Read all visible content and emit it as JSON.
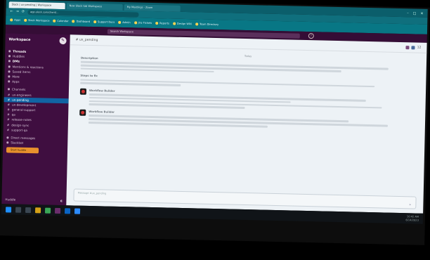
{
  "browser": {
    "tabs": [
      {
        "label": "Slack | ux-pending | Workspace"
      },
      {
        "label": "New Slack tab Workspace"
      },
      {
        "label": "My Meetings - Zoom"
      }
    ],
    "url": "app.slack.com/client/...",
    "bookmarks": [
      "Apps",
      "Slack Workspace",
      "Calendar",
      "Dashboard",
      "Support Docs",
      "Admin",
      "Jira Tickets",
      "Reports",
      "Design Wiki",
      "Team Directory"
    ]
  },
  "slack": {
    "workspace_name": "Workspace",
    "search_placeholder": "Search Workspace",
    "sidebar": {
      "top_items": [
        "Threads",
        "Huddles",
        "DMs",
        "Mentions & reactions",
        "Saved items",
        "More",
        "Apps"
      ],
      "channels_header": "Channels",
      "channels": [
        "ux-engineers",
        "ux-pending",
        "ux-development",
        "general-support",
        "qa",
        "release-notes",
        "design-sync",
        "support-qa"
      ],
      "dm_header": "Direct messages",
      "dms": [
        "Slackbot"
      ],
      "huddle_label": "Start huddle",
      "footer_label": "Huddle"
    },
    "channel": {
      "name": "# ux_pending",
      "member_count": "12",
      "date_label": "Today",
      "sections": [
        {
          "title": "Description",
          "lines": 3
        },
        {
          "title": "Steps to fix",
          "lines": 2
        }
      ],
      "messages": [
        {
          "author": "Workflow Builder",
          "lines": 4
        },
        {
          "author": "Workflow Builder",
          "lines": 3
        }
      ],
      "input_placeholder": "Message #ux_pending"
    }
  },
  "taskbar": {
    "time": "10:42 AM",
    "date": "6/14/2023"
  }
}
